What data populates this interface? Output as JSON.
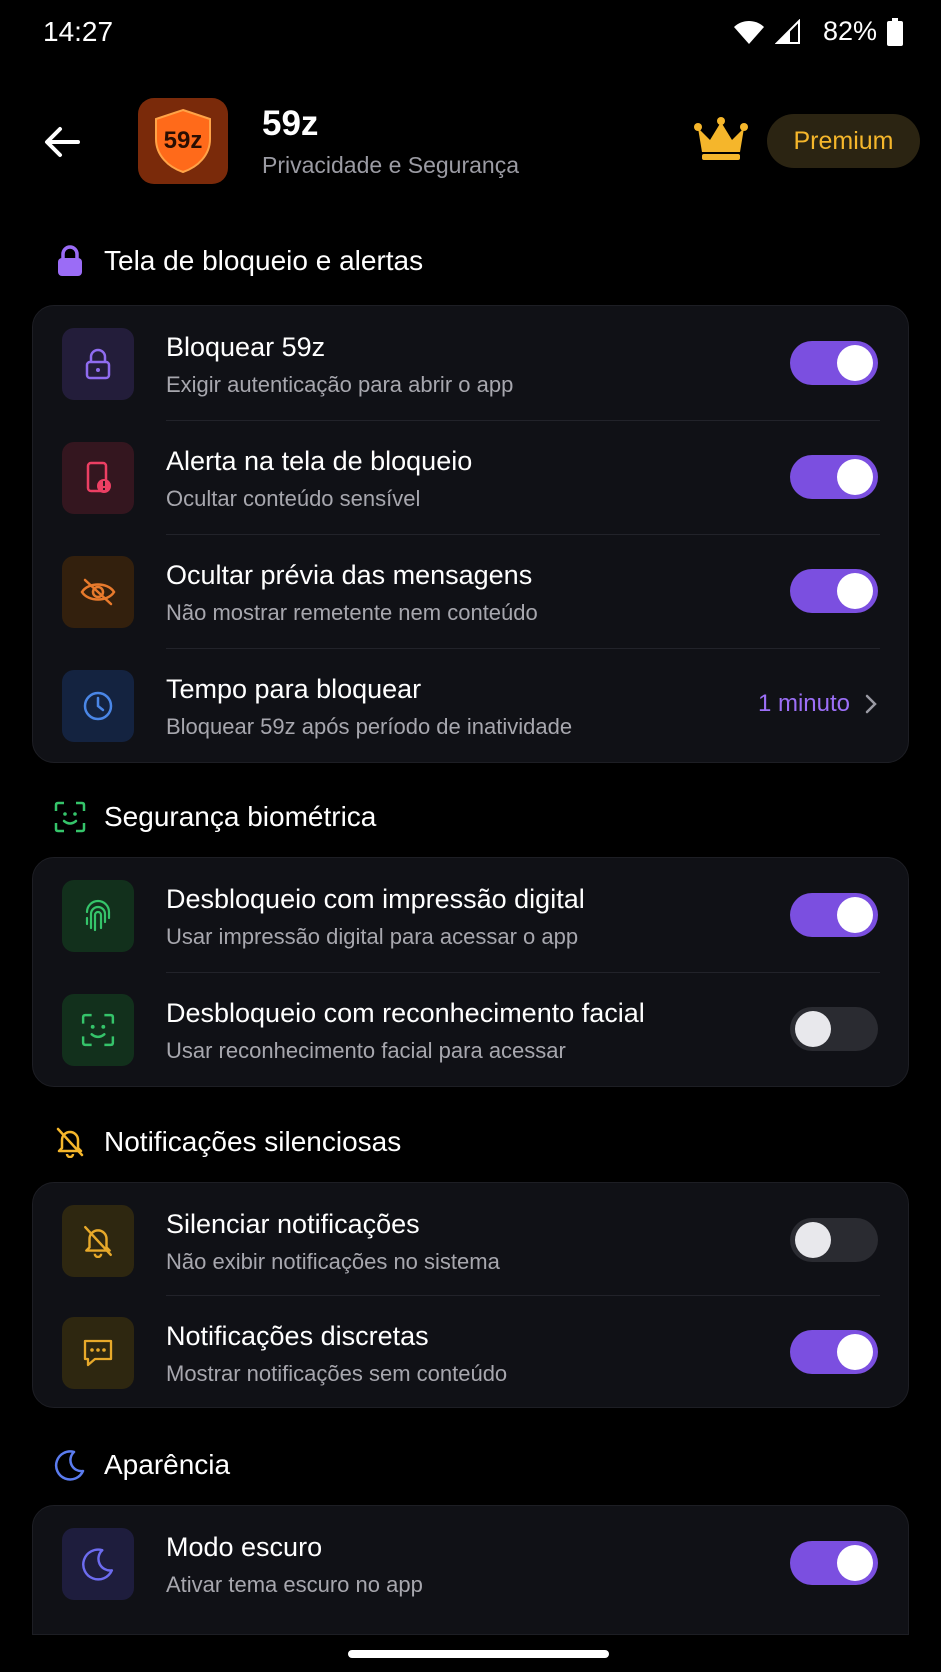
{
  "status": {
    "time": "14:27",
    "battery": "82%"
  },
  "header": {
    "logo_text": "59z",
    "title": "59z",
    "subtitle": "Privacidade e Segurança",
    "premium_label": "Premium"
  },
  "sections": {
    "lock": {
      "title": "Tela de bloqueio e alertas",
      "rows": [
        {
          "title": "Bloquear 59z",
          "subtitle": "Exigir autenticação para abrir o app",
          "toggle": true
        },
        {
          "title": "Alerta na tela de bloqueio",
          "subtitle": "Ocultar conteúdo sensível",
          "toggle": true
        },
        {
          "title": "Ocultar prévia das mensagens",
          "subtitle": "Não mostrar remetente nem conteúdo",
          "toggle": true
        },
        {
          "title": "Tempo para bloquear",
          "subtitle": "Bloquear 59z após período de inatividade",
          "value": "1 minuto"
        }
      ]
    },
    "biometric": {
      "title": "Segurança biométrica",
      "rows": [
        {
          "title": "Desbloqueio com impressão digital",
          "subtitle": "Usar impressão digital para acessar o app",
          "toggle": true
        },
        {
          "title": "Desbloqueio com reconhecimento facial",
          "subtitle": "Usar reconhecimento facial para acessar",
          "toggle": false
        }
      ]
    },
    "silent": {
      "title": "Notificações silenciosas",
      "rows": [
        {
          "title": "Silenciar notificações",
          "subtitle": "Não exibir notificações no sistema",
          "toggle": false
        },
        {
          "title": "Notificações discretas",
          "subtitle": "Mostrar notificações sem conteúdo",
          "toggle": true
        }
      ]
    },
    "appearance": {
      "title": "Aparência",
      "rows": [
        {
          "title": "Modo escuro",
          "subtitle": "Ativar tema escuro no app",
          "toggle": true
        }
      ]
    }
  },
  "colors": {
    "accent": "#7b4fe0",
    "value_text": "#9c6ff7",
    "premium": "#f5b62b",
    "logo_bg": "#ff6a1a"
  },
  "icons": {
    "lock_section": "lock-icon",
    "biometric_section": "face-scan-icon",
    "silent_section": "bell-off-icon",
    "appearance_section": "moon-icon"
  }
}
